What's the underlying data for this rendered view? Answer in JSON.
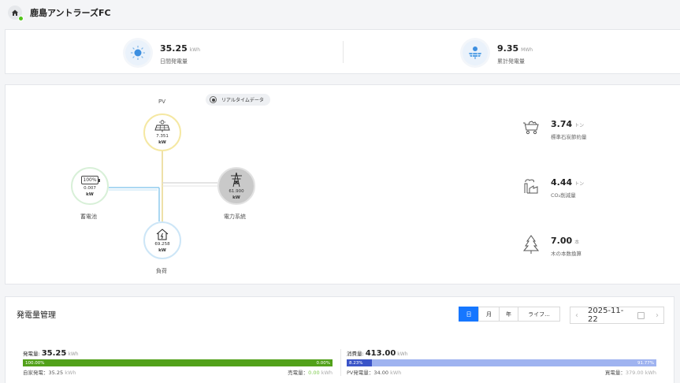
{
  "header": {
    "title": "鹿島アントラーズFC",
    "home_icon": "home-icon"
  },
  "summary": {
    "daily": {
      "value": "35.25",
      "unit": "kWh",
      "label": "日間発電量",
      "icon": "sun-icon"
    },
    "total": {
      "value": "9.35",
      "unit": "MWh",
      "label": "累計発電量",
      "icon": "solar-panel-icon"
    }
  },
  "flow": {
    "realtime_label": "リアルタイムデータ",
    "pv": {
      "label": "PV",
      "value": "7.351",
      "unit": "kW"
    },
    "battery": {
      "label": "蓄電池",
      "value": "0.007",
      "unit": "kW",
      "badge": "100%"
    },
    "grid": {
      "label": "電力系統",
      "value": "61.900",
      "unit": "kW"
    },
    "load": {
      "label": "負荷",
      "value": "69.258",
      "unit": "kW"
    }
  },
  "environment": [
    {
      "value": "3.74",
      "unit": "トン",
      "label": "標準石炭節約量",
      "icon": "coal-cart-icon"
    },
    {
      "value": "4.44",
      "unit": "トン",
      "label": "CO₂削減量",
      "icon": "factory-icon"
    },
    {
      "value": "7.00",
      "unit": "本",
      "label": "木の本数換算",
      "icon": "tree-icon"
    }
  ],
  "management": {
    "title": "発電量管理",
    "tabs": [
      "日",
      "月",
      "年",
      "ライフ..."
    ],
    "active_tab": "日",
    "date": "2025-11-22",
    "generation": {
      "label": "発電量:",
      "value": "35.25",
      "unit": "kWh",
      "left_pct": "100.00%",
      "right_pct": "0.00%",
      "fill": 1.0,
      "self_label": "自家発電：",
      "self_value": "35.25",
      "self_unit": "kWh",
      "feed_label": "売電量：",
      "feed_value": "0.00",
      "feed_unit": "kWh"
    },
    "consumption": {
      "label": "消費量:",
      "value": "413.00",
      "unit": "kWh",
      "left_pct": "8.23%",
      "right_pct": "91.77%",
      "fill": 0.0823,
      "pv_label": "PV発電量：",
      "pv_value": "34.00",
      "pv_unit": "kWh",
      "buy_label": "買電量：",
      "buy_value": "379.00",
      "buy_unit": "kWh"
    }
  },
  "colors": {
    "accent": "#1677ff",
    "gen_bar": "#52a11a",
    "cons_dark": "#3a54c8",
    "cons_light": "#9fb3f0",
    "feed_value": "#7cc94a"
  }
}
